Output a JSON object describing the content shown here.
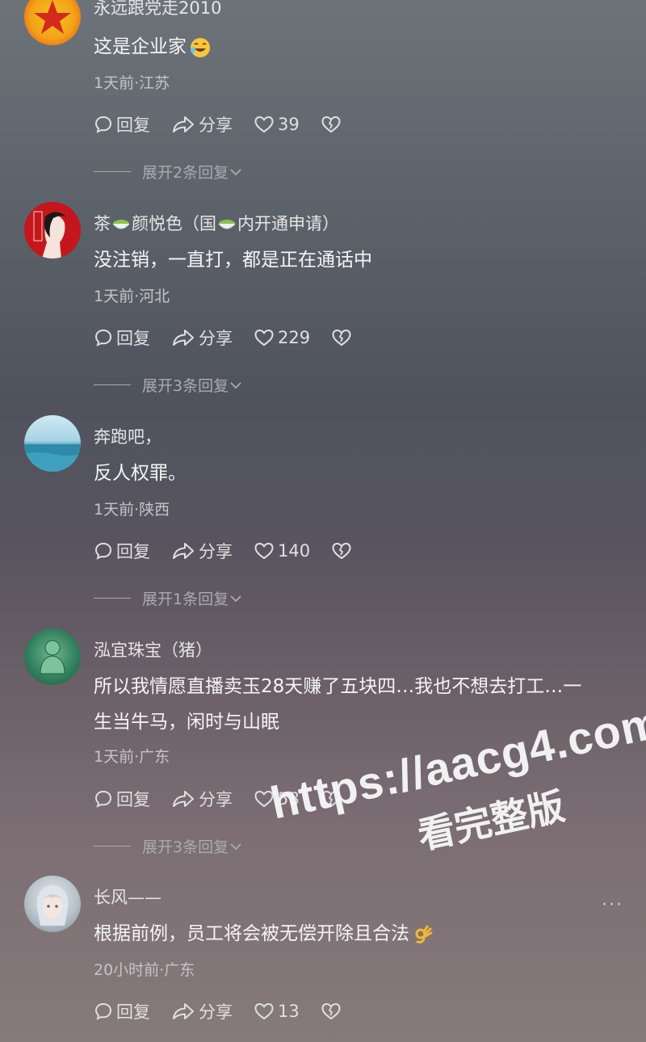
{
  "comments": [
    {
      "username": "永远跟党走2010",
      "text": "这是企业家",
      "meta": "1天前·江苏",
      "reply_label": "回复",
      "share_label": "分享",
      "likes": "39",
      "expand_label": "展开2条回复",
      "avatar": "star-flag-avatar"
    },
    {
      "username_parts": [
        "茶",
        "颜悦色（国",
        "内开通申请）"
      ],
      "text": "没注销，一直打，都是正在通话中",
      "meta": "1天前·河北",
      "reply_label": "回复",
      "share_label": "分享",
      "likes": "229",
      "expand_label": "展开3条回复",
      "avatar": "red-portrait-avatar"
    },
    {
      "username": "奔跑吧，",
      "text": "反人权罪。",
      "meta": "1天前·陕西",
      "reply_label": "回复",
      "share_label": "分享",
      "likes": "140",
      "expand_label": "展开1条回复",
      "avatar": "sea-avatar"
    },
    {
      "username": "泓宜珠宝（猪）",
      "text_lines": [
        "所以我情愿直播卖玉28天赚了五块四…我也不想去打工…一",
        "生当牛马，闲时与山眠"
      ],
      "meta": "1天前·广东",
      "reply_label": "回复",
      "share_label": "分享",
      "likes": "58",
      "expand_label": "展开3条回复",
      "avatar": "jade-buddha-avatar"
    },
    {
      "username": "长风——",
      "text": "根据前例，员工将会被无偿开除且合法",
      "meta": "20小时前·广东",
      "reply_label": "回复",
      "share_label": "分享",
      "likes": "13",
      "avatar": "anime-avatar"
    }
  ],
  "more_label": "···",
  "watermark": {
    "line1": "https://aacg4.com",
    "line2": "看完整版"
  }
}
